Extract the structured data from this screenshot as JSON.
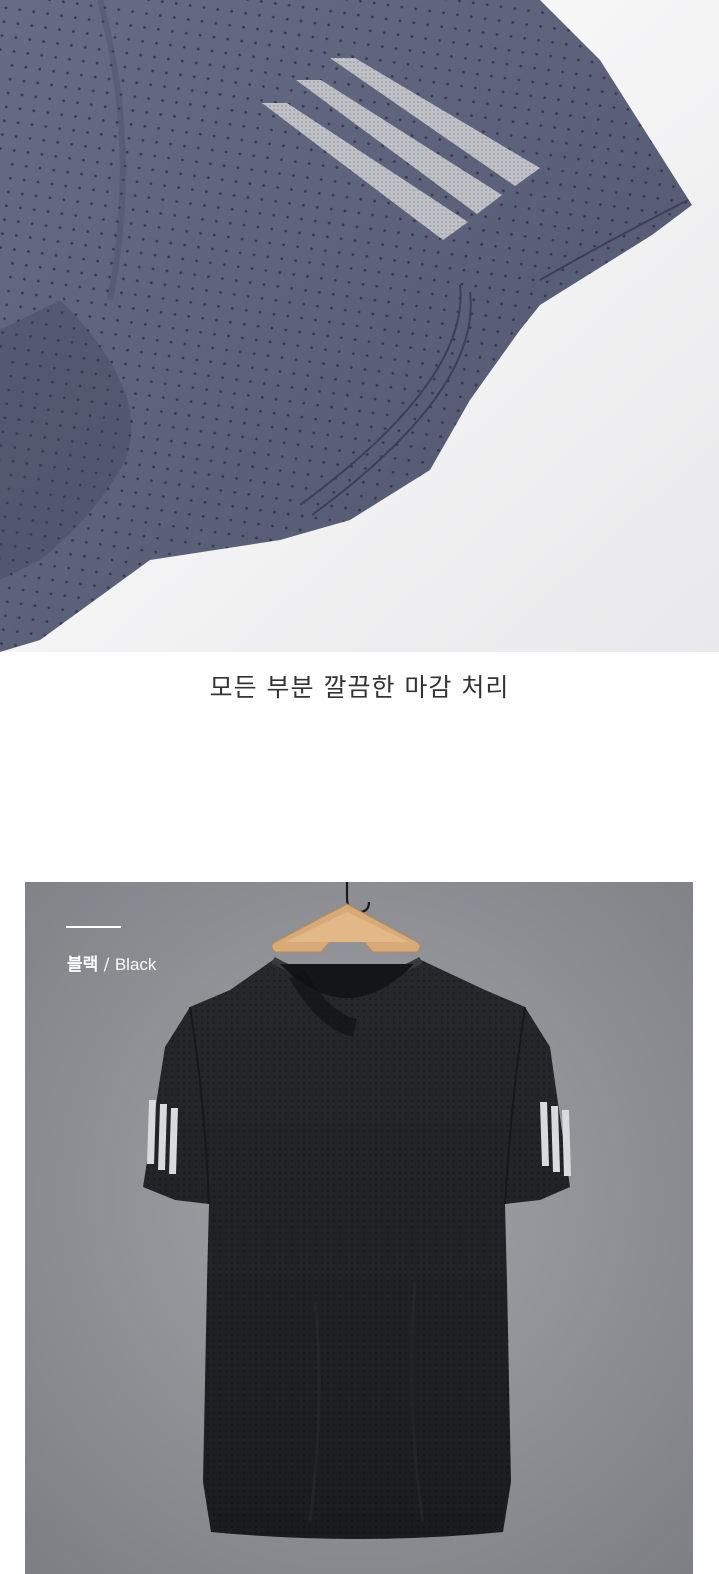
{
  "caption": "모든 부분 깔끔한 마감 처리",
  "color_option": {
    "label_ko": "블랙",
    "separator": " / ",
    "label_en": "Black"
  },
  "colors": {
    "sleeve_fabric": "#5c627a",
    "shirt": "#1f2124",
    "backdrop": "#8d8e93",
    "hanger": "#d8aa78"
  }
}
